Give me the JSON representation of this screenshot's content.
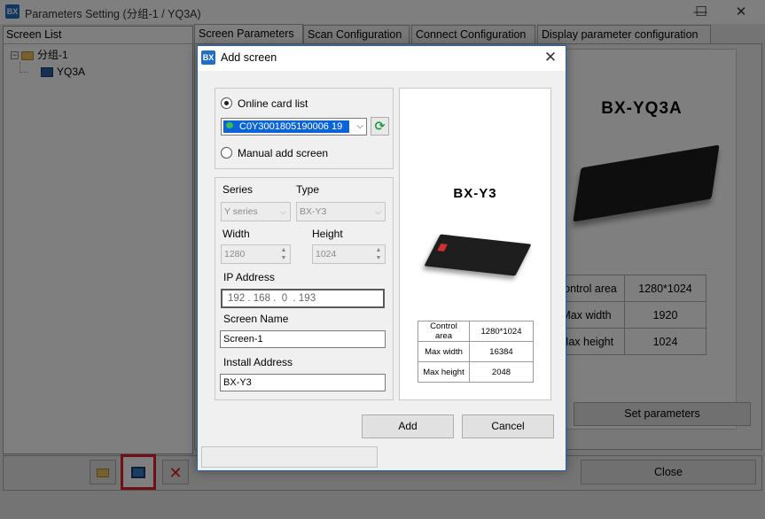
{
  "window": {
    "icon_text": "BX",
    "title": "Parameters Setting   (分组-1 / YQ3A)",
    "minimize_glyph": "—",
    "maximize_glyph": "☐",
    "close_glyph": "✕"
  },
  "screen_list": {
    "header": "Screen List",
    "group_expander": "−",
    "group_label": "分组-1",
    "screen_label": "YQ3A"
  },
  "tabs": [
    {
      "label": "Screen Parameters",
      "active": true
    },
    {
      "label": "Scan Configuration"
    },
    {
      "label": "Connect Configuration"
    },
    {
      "label": "Display parameter configuration"
    }
  ],
  "background_product": {
    "title": "BX-YQ3A",
    "rows": [
      {
        "label": "Control area",
        "value": "1280*1024"
      },
      {
        "label": "Max width",
        "value": "1920"
      },
      {
        "label": "Max height",
        "value": "1024"
      }
    ],
    "set_button": "Set parameters"
  },
  "toolbar": {
    "delete_glyph": "✕",
    "close_label": "Close"
  },
  "dialog": {
    "icon_text": "BX",
    "title": "Add screen",
    "close_glyph": "✕",
    "online_label": "Online card list",
    "card_value": "C0Y3001805190006    19",
    "dropdown_glyph": "⌵",
    "refresh_glyph": "⟳",
    "manual_label": "Manual add screen",
    "series_label": "Series",
    "series_value": "Y series",
    "type_label": "Type",
    "type_value": "BX-Y3",
    "width_label": "Width",
    "width_value": "1280",
    "height_label": "Height",
    "height_value": "1024",
    "spin_up": "▲",
    "spin_down": "▼",
    "ip_label": "IP Address",
    "ip_value": "192 . 168 .  0  . 193",
    "name_label": "Screen Name",
    "name_value": "Screen-1",
    "install_label": "Install Address",
    "install_value": "BX-Y3",
    "preview_title": "BX-Y3",
    "preview_rows": [
      {
        "label": "Control area",
        "value": "1280*1024"
      },
      {
        "label": "Max width",
        "value": "16384"
      },
      {
        "label": "Max height",
        "value": "2048"
      }
    ],
    "add_button": "Add",
    "cancel_button": "Cancel"
  }
}
